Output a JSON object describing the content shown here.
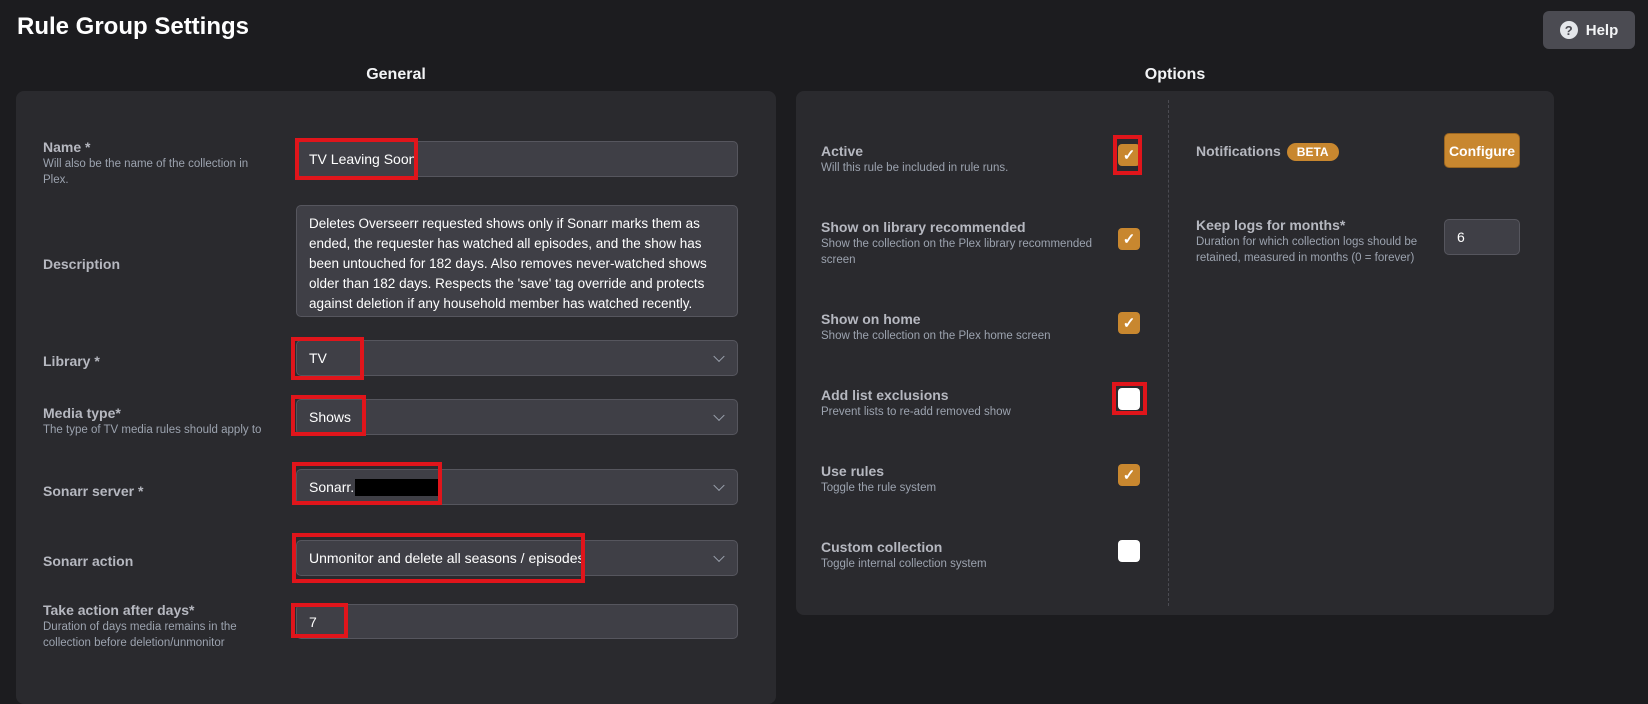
{
  "header": {
    "title": "Rule Group Settings",
    "help_label": "Help"
  },
  "general": {
    "heading": "General",
    "name": {
      "label": "Name *",
      "help": "Will also be the name of the collection in Plex.",
      "value": "TV Leaving Soon"
    },
    "description": {
      "label": "Description",
      "value": "Deletes Overseerr requested shows only if Sonarr marks them as ended, the requester has watched all episodes, and the show has been untouched for 182 days. Also removes never-watched shows older than 182 days. Respects the 'save' tag override and protects against deletion if any household member has watched recently."
    },
    "library": {
      "label": "Library *",
      "value": "TV"
    },
    "media_type": {
      "label": "Media type*",
      "help": "The type of TV media rules should apply to",
      "value": "Shows"
    },
    "sonarr_server": {
      "label": "Sonarr server *",
      "value": "Sonarr."
    },
    "sonarr_action": {
      "label": "Sonarr action",
      "value": "Unmonitor and delete all seasons / episodes"
    },
    "take_action": {
      "label": "Take action after days*",
      "help": "Duration of days media remains in the collection before deletion/unmonitor",
      "value": "7"
    }
  },
  "options": {
    "heading": "Options",
    "active": {
      "label": "Active",
      "help": "Will this rule be included in rule runs.",
      "checked": true
    },
    "library_recommended": {
      "label": "Show on library recommended",
      "help": "Show the collection on the Plex library recommended screen",
      "checked": true
    },
    "show_on_home": {
      "label": "Show on home",
      "help": "Show the collection on the Plex home screen",
      "checked": true
    },
    "list_exclusions": {
      "label": "Add list exclusions",
      "help": "Prevent lists to re-add removed show",
      "checked": false
    },
    "use_rules": {
      "label": "Use rules",
      "help": "Toggle the rule system",
      "checked": true
    },
    "custom_collection": {
      "label": "Custom collection",
      "help": "Toggle internal collection system",
      "checked": false
    },
    "notifications": {
      "label": "Notifications",
      "badge": "BETA",
      "button": "Configure"
    },
    "keep_logs": {
      "label": "Keep logs for months*",
      "help": "Duration for which collection logs should be retained, measured in months (0 = forever)",
      "value": "6"
    }
  },
  "colors": {
    "accent": "#c8872f",
    "highlight": "#e0151b",
    "panel": "#2a2a2e",
    "background": "#1c1c1f"
  }
}
